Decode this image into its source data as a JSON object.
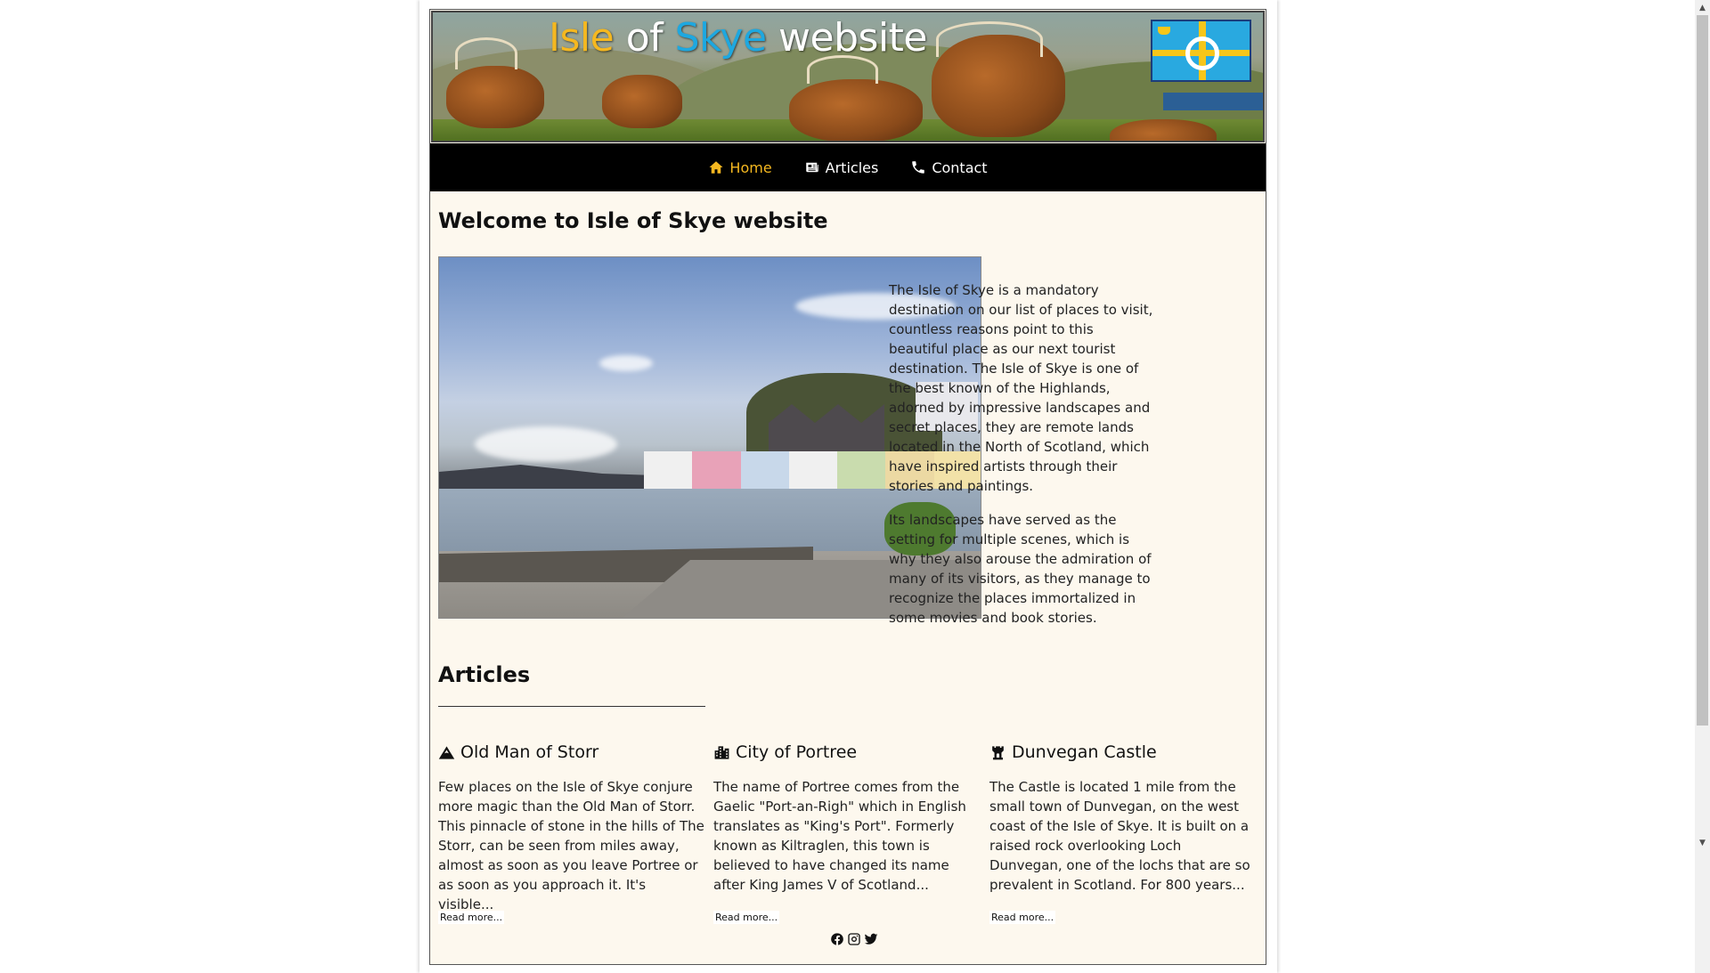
{
  "banner": {
    "title_isle": "Isle",
    "title_of": " of ",
    "title_skye": "Skye",
    "title_website": " website",
    "colors": {
      "isle": "#f5b820",
      "skye": "#1ea8e0",
      "flag_blue": "#29a9e0",
      "flag_yellow": "#f7c61a"
    }
  },
  "nav": {
    "items": [
      {
        "label": "Home",
        "icon": "home-icon",
        "active": true
      },
      {
        "label": "Articles",
        "icon": "newspaper-icon",
        "active": false
      },
      {
        "label": "Contact",
        "icon": "phone-icon",
        "active": false
      }
    ],
    "active_color": "#f5b820"
  },
  "welcome": {
    "title": "Welcome to Isle of Skye website",
    "paragraphs": [
      "The Isle of Skye is a mandatory destination on our list of places to visit, countless reasons point to this beautiful place as our next tourist destination. The Isle of Skye is one of the best known of the Highlands, adorned by impressive landscapes and secret places, they are remote lands located in the North of Scotland, which have inspired artists through their stories and paintings.",
      "Its landscapes have served as the setting for multiple scenes, which is why they also arouse the admiration of many of its visitors, as they manage to recognize the places immortalized in some movies and book stories."
    ]
  },
  "articles": {
    "title": "Articles",
    "items": [
      {
        "icon": "mountain-icon",
        "title": "Old Man of Storr",
        "excerpt": "Few places on the Isle of Skye conjure more magic than the Old Man of Storr. This pinnacle of stone in the hills of The Storr, can be seen from miles away, almost as soon as you leave Portree or as soon as you approach it. It's visible...",
        "read_more": "Read more..."
      },
      {
        "icon": "city-icon",
        "title": "City of Portree",
        "excerpt": "The name of Portree comes from the Gaelic \"Port-an-Righ\" which in English translates as \"King's Port\". Formerly known as Kiltraglen, this town is believed to have changed its name after King James V of Scotland...",
        "read_more": "Read more..."
      },
      {
        "icon": "castle-icon",
        "title": "Dunvegan Castle",
        "excerpt": "The Castle is located 1 mile from the small town of Dunvegan, on the west coast of the Isle of Skye. It is built on a raised rock overlooking Loch Dunvegan, one of the lochs that are so prevalent in Scotland. For 800 years...",
        "read_more": "Read more..."
      }
    ]
  },
  "footer": {
    "social": [
      "facebook-icon",
      "instagram-icon",
      "twitter-icon"
    ]
  }
}
